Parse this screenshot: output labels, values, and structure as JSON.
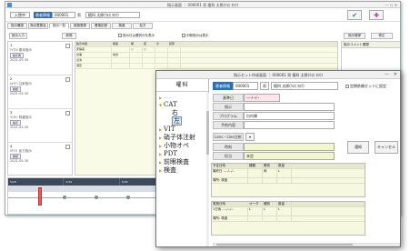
{
  "back": {
    "title": "指示画面 ｜ 000001 男 植科 太郎(ｳｴｶ ﾀﾛｳ)",
    "window_controls": "— ☐ ✕",
    "badge": "入院中",
    "pid_label": "患者情報",
    "pid": "000001",
    "sex": "男",
    "name": "植科 太郎(ｳｴｶ ﾀﾛｳ)",
    "big_button_1": "✔",
    "big_button_2": "✚",
    "tabs": [
      "指示確認",
      "指示歴照会",
      "指示一覧",
      "実施登録",
      "看護記録",
      "検査",
      "処方"
    ],
    "toolbar": {
      "left_button": "指示入力",
      "right_button": "新規",
      "check_1": "指示日は選択分を表示",
      "check_2": "中断指示は表示",
      "btn_a": "指示登録",
      "btn_b": "修正"
    },
    "entries": [
      {
        "title": "1",
        "sub": "ｱｲｳｴｵ 基本指示",
        "tag": "指示者",
        "date": "2021-05-30"
      },
      {
        "title": "2",
        "sub": "ｶｷｸｹｺ 注射指示",
        "tag": "確認",
        "date": "2021-05-30"
      },
      {
        "title": "3",
        "sub": "ｻｼｽｾｿ 検査指示",
        "tag": "指示",
        "date": "2021-05-30"
      },
      {
        "title": "4",
        "sub": "ﾀﾁﾂﾃﾄ 処方指示",
        "tag": "確認",
        "date": "2021-05-30"
      }
    ],
    "grid_head": [
      "指示内容",
      "頻度",
      "朝",
      "昼",
      "夕",
      "就寝"
    ],
    "grid_rows": [
      [
        "安静度",
        "",
        "○",
        "○",
        "",
        ""
      ],
      [
        "食事",
        "常食",
        "",
        "",
        "",
        ""
      ],
      [
        "点滴",
        "",
        "",
        "",
        "",
        ""
      ],
      [
        "測定",
        "",
        "",
        "",
        "",
        ""
      ]
    ],
    "rpanel_head": "指示コメント履歴",
    "timeline_cols": [
      "5/28",
      "5/29",
      "5/30",
      "5/31",
      "6/1",
      "6/2",
      "6/3"
    ]
  },
  "front": {
    "title": "指示セット作成画面 ｜ 000001 男 植科 太郎(ｳｴｶ ﾀﾛｳ)",
    "minimize": "—",
    "close": "✕",
    "left_header": "曜科",
    "tree": [
      {
        "label": "-------",
        "size": "sm",
        "sub": false,
        "sel": false
      },
      {
        "label": "CAT",
        "size": "lg",
        "sub": false,
        "sel": false
      },
      {
        "label": "右",
        "size": "lg",
        "sub": true,
        "sel": false
      },
      {
        "label": "左",
        "size": "lg",
        "sub": true,
        "sel": true
      },
      {
        "label": "VIT",
        "size": "lg",
        "sub": false,
        "sel": false
      },
      {
        "label": "硝子体注射",
        "size": "lg",
        "sub": false,
        "sel": false
      },
      {
        "label": "小物オペ",
        "size": "lg",
        "sub": false,
        "sel": false
      },
      {
        "label": "PDT",
        "size": "lg",
        "sub": false,
        "sel": false
      },
      {
        "label": "前眼検査",
        "size": "lg",
        "sub": false,
        "sel": false
      },
      {
        "label": "検査",
        "size": "lg",
        "sub": false,
        "sel": false
      }
    ],
    "patient_label": "患者情報",
    "patient_id": "000001",
    "sex": "男",
    "name": "植科 太郎(ｳｴｶ ﾀﾛｳ)",
    "fixed_check": "定期依頼セットに設定",
    "schedule_label": "基準日",
    "schedule_value": "----/--/--",
    "order_label": "指示",
    "order_value": "",
    "program_label": "プログラム",
    "program_value": "白内障",
    "memo_label": "予約内容",
    "memo_value": "",
    "lens_label": "Lens・Line注射",
    "lens_button": "▾",
    "time_label": "時刻",
    "time_value": "",
    "doctor_label": "担当",
    "doctor_value": "未定",
    "notify_button": "通知",
    "cancel_button": "キャンセル",
    "tbl1_head": [
      "予定日時",
      "種類",
      "眼別",
      "数量"
    ],
    "tbl1_rows": [
      [
        "最終日 ----/--/--",
        "",
        "両",
        "L"
      ],
      [
        "場所: 検査",
        "",
        "",
        ""
      ]
    ],
    "tbl2_head": [
      "実施日時",
      "オーダ",
      "種別",
      "数量"
    ],
    "tbl2_rows": [
      [
        "1日後 ----/--/--",
        "L",
        "L",
        "L"
      ],
      [
        "場所: 検査",
        "",
        "",
        ""
      ]
    ]
  }
}
